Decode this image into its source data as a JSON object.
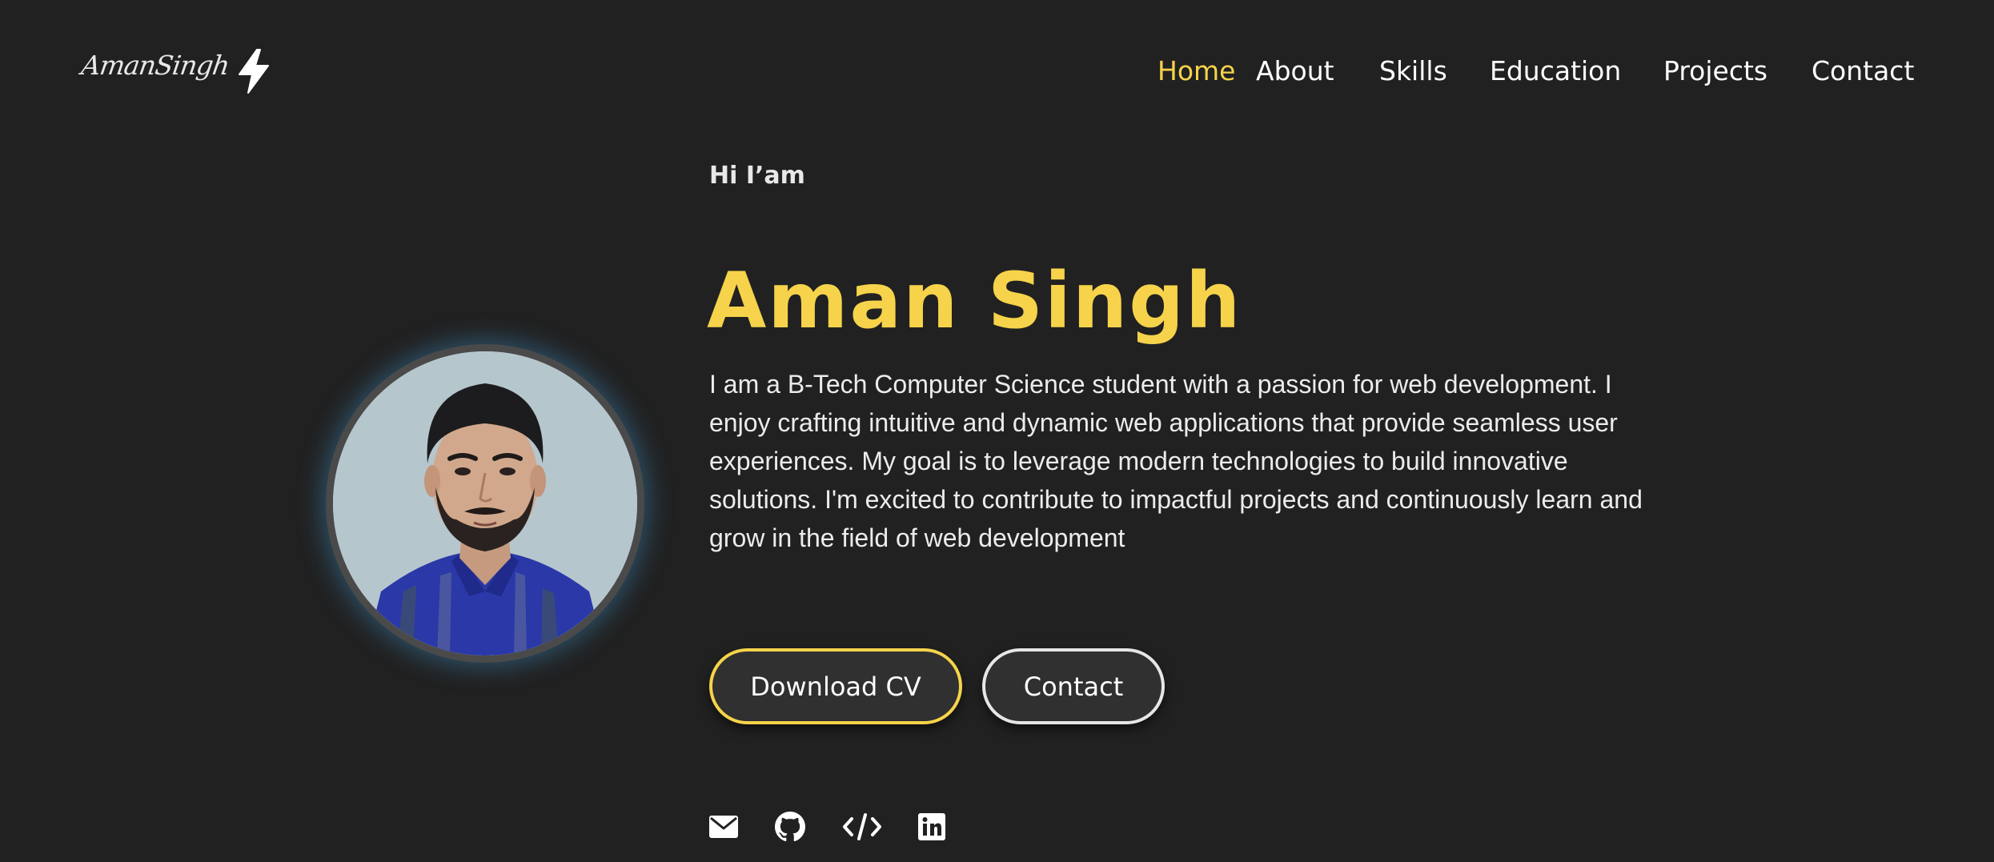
{
  "header": {
    "logo_text": "AmanSingh",
    "theme_toggle_icon": "lightning-bolt-icon"
  },
  "nav": {
    "items": [
      {
        "label": "Home",
        "active": true
      },
      {
        "label": "About",
        "active": false
      },
      {
        "label": "Skills",
        "active": false
      },
      {
        "label": "Education",
        "active": false
      },
      {
        "label": "Projects",
        "active": false
      },
      {
        "label": "Contact",
        "active": false
      }
    ]
  },
  "hero": {
    "greeting": "Hi I’am",
    "name": "Aman Singh",
    "bio": "I am a B-Tech Computer Science student with a passion for web development. I enjoy crafting intuitive and dynamic web applications that provide seamless user experiences. My goal is to leverage modern technologies to build innovative solutions. I'm excited to contribute to impactful projects and continuously learn and grow in the field of web development",
    "buttons": {
      "download_cv": "Download CV",
      "contact": "Contact"
    },
    "avatar_icon": "profile-photo"
  },
  "social": {
    "icons": [
      "mail-icon",
      "github-icon",
      "code-icon",
      "linkedin-icon"
    ]
  },
  "colors": {
    "background": "#212121",
    "accent": "#f6d34a",
    "text": "#ffffff",
    "button_bg": "#303030"
  }
}
